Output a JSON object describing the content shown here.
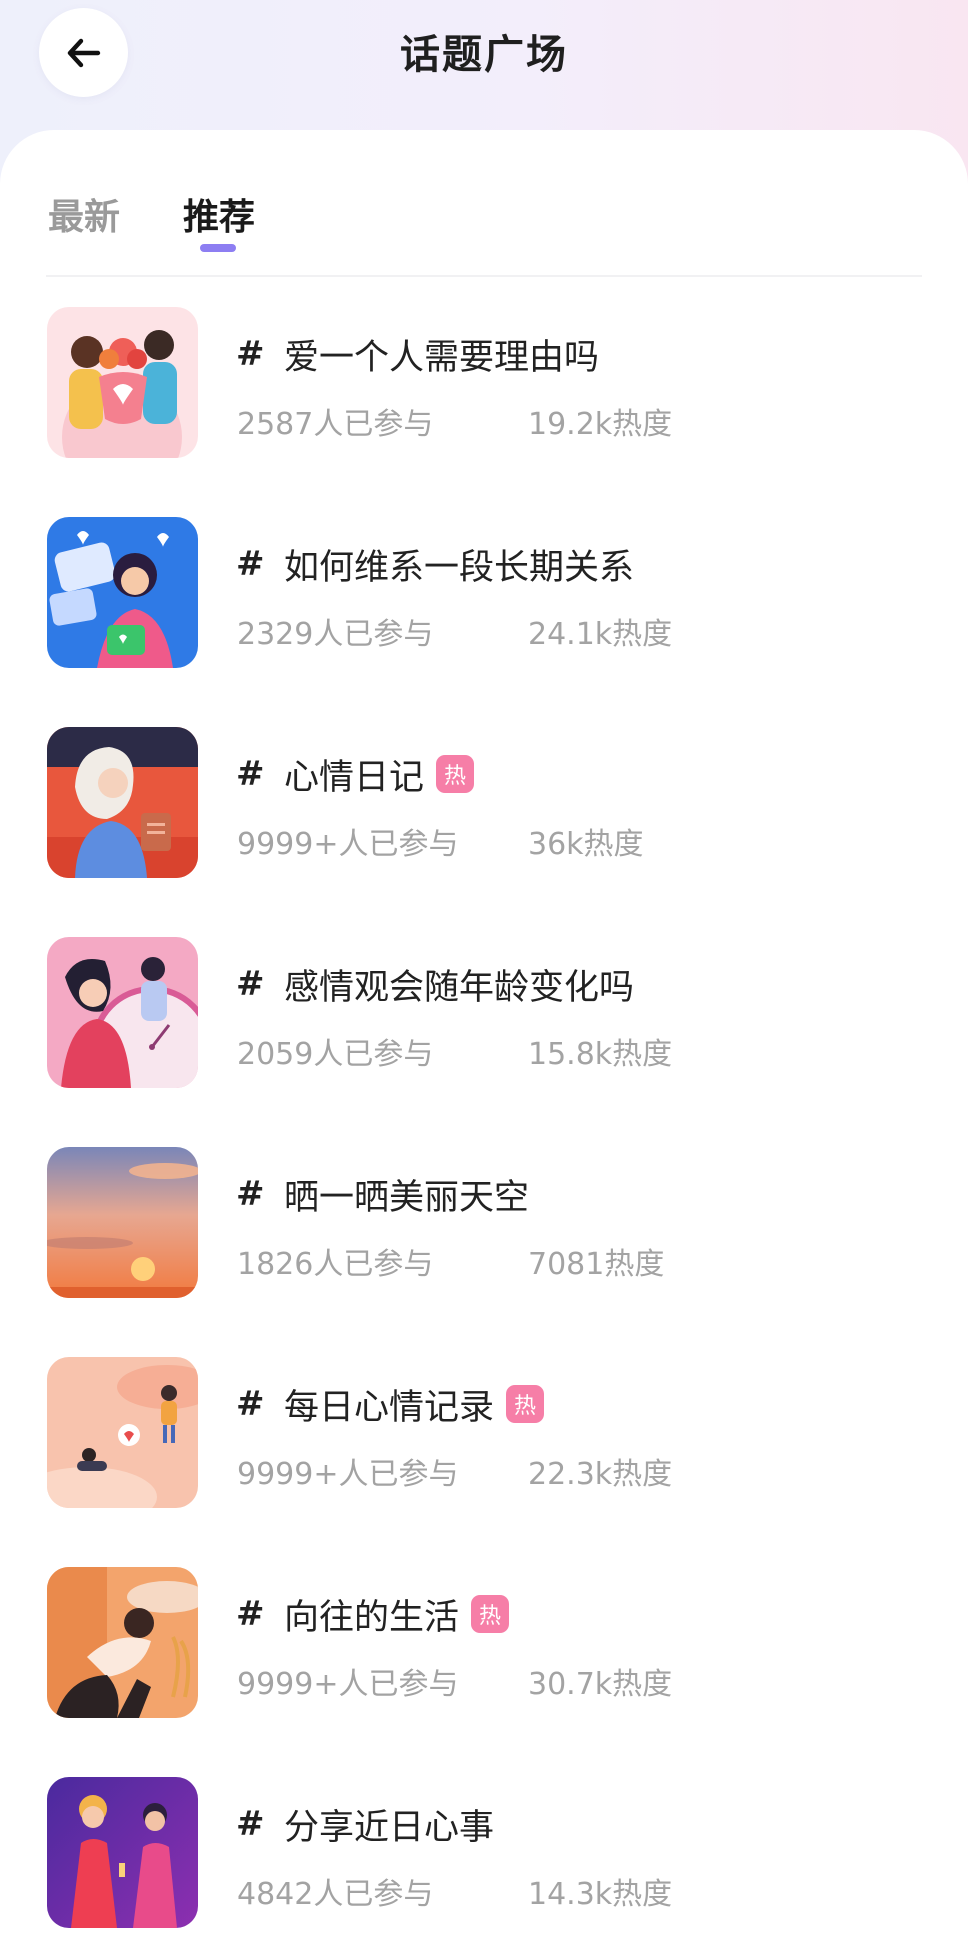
{
  "header": {
    "title": "话题广场",
    "back_icon": "arrow-left-icon"
  },
  "tabs": [
    {
      "label": "最新",
      "active": false
    },
    {
      "label": "推荐",
      "active": true
    }
  ],
  "accent_color": "#8d7ef2",
  "hot_badge_color": "#f67ea7",
  "topics": [
    {
      "title": "爱一个人需要理由吗",
      "participants": "2587人已参与",
      "heat": "19.2k热度",
      "hot": false
    },
    {
      "title": "如何维系一段长期关系",
      "participants": "2329人已参与",
      "heat": "24.1k热度",
      "hot": false
    },
    {
      "title": "心情日记",
      "participants": "9999+人已参与",
      "heat": "36k热度",
      "hot": true,
      "badge": "热"
    },
    {
      "title": "感情观会随年龄变化吗",
      "participants": "2059人已参与",
      "heat": "15.8k热度",
      "hot": false
    },
    {
      "title": "晒一晒美丽天空",
      "participants": "1826人已参与",
      "heat": "7081热度",
      "hot": false
    },
    {
      "title": "每日心情记录",
      "participants": "9999+人已参与",
      "heat": "22.3k热度",
      "hot": true,
      "badge": "热"
    },
    {
      "title": "向往的生活",
      "participants": "9999+人已参与",
      "heat": "30.7k热度",
      "hot": true,
      "badge": "热"
    },
    {
      "title": "分享近日心事",
      "participants": "4842人已参与",
      "heat": "14.3k热度",
      "hot": false
    }
  ]
}
